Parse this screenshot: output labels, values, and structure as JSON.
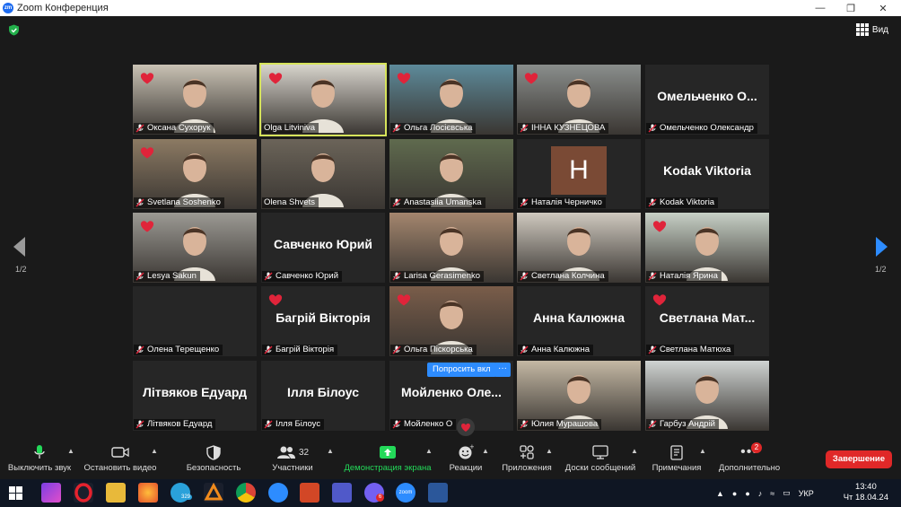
{
  "window": {
    "title": "Zoom Конференция",
    "logo": "zm"
  },
  "view": {
    "label": "Вид"
  },
  "pagination": {
    "left": "1/2",
    "right": "1/2"
  },
  "participants": [
    {
      "name": "Оксана Сухорук",
      "big": "",
      "heart": true,
      "muted": true,
      "bg": "#c9c2b4"
    },
    {
      "name": "Olga Litvinіva",
      "big": "",
      "heart": true,
      "muted": false,
      "bg": "#d7d4cc",
      "active": true
    },
    {
      "name": "Ольга Лосієвська",
      "big": "",
      "heart": true,
      "muted": true,
      "bg": "#5d8a9a"
    },
    {
      "name": "ІННА КУЗНЕЦОВА",
      "big": "",
      "heart": true,
      "muted": true,
      "bg": "#8a8e8c"
    },
    {
      "name": "Омельченко Олександр",
      "big": "Омельченко  О...",
      "heart": false,
      "muted": true,
      "bg": "#262626"
    },
    {
      "name": "Svetlana Soshenko",
      "big": "",
      "heart": true,
      "muted": true,
      "bg": "#8c7a63"
    },
    {
      "name": "Olena Shvets",
      "big": "",
      "heart": false,
      "muted": false,
      "bg": "#6b6459"
    },
    {
      "name": "Anastasiia Umanska",
      "big": "",
      "heart": false,
      "muted": true,
      "bg": "#5f6a4e"
    },
    {
      "name": "Наталія Черничко",
      "big": "",
      "heart": false,
      "muted": true,
      "bg": "#262626",
      "initial": "H"
    },
    {
      "name": "Kodak Viktoria",
      "big": "Kodak Viktoria",
      "heart": false,
      "muted": true,
      "bg": "#262626"
    },
    {
      "name": "Lesya Sakun",
      "big": "",
      "heart": true,
      "muted": true,
      "bg": "#9c9a94"
    },
    {
      "name": "Савченко Юрий",
      "big": "Савченко Юрий",
      "heart": false,
      "muted": true,
      "bg": "#262626"
    },
    {
      "name": "Larisa Gerasimenko",
      "big": "",
      "heart": false,
      "muted": true,
      "bg": "#a4866e"
    },
    {
      "name": "Светлана Колчина",
      "big": "",
      "heart": false,
      "muted": true,
      "bg": "#cfc9bf"
    },
    {
      "name": "Наталія Ярина",
      "big": "",
      "heart": true,
      "muted": true,
      "bg": "#c7d0c6"
    },
    {
      "name": "Олена Терещенко",
      "big": "",
      "heart": false,
      "muted": true,
      "bg": "#262626"
    },
    {
      "name": "Багрій Вікторія",
      "big": "Багрій Вікторія",
      "heart": true,
      "muted": true,
      "bg": "#262626"
    },
    {
      "name": "Ольга Піскорська",
      "big": "",
      "heart": true,
      "muted": true,
      "bg": "#7a5d4a"
    },
    {
      "name": "Анна Калюжна",
      "big": "Анна Калюжна",
      "heart": false,
      "muted": true,
      "bg": "#262626"
    },
    {
      "name": "Светлана Матюха",
      "big": "Светлана  Мат...",
      "heart": true,
      "muted": true,
      "bg": "#262626"
    },
    {
      "name": "Літвяков Едуард",
      "big": "Літвяков Едуард",
      "heart": false,
      "muted": true,
      "bg": "#262626"
    },
    {
      "name": "Ілля Білоус",
      "big": "Ілля Білоус",
      "heart": false,
      "muted": true,
      "bg": "#262626"
    },
    {
      "name": "Мойленко Олена",
      "big": "Мойленко  Оле...",
      "heart": false,
      "muted": true,
      "bg": "#262626"
    },
    {
      "name": "Юлия Мурашова",
      "big": "",
      "heart": false,
      "muted": true,
      "bg": "#c4b8a4"
    },
    {
      "name": "Гарбуз Андрій",
      "big": "",
      "heart": false,
      "muted": true,
      "bg": "#cfd3d2"
    }
  ],
  "namebar_truncated": {
    "22": "Мойленко О"
  },
  "overlay": {
    "ask_button": "Попросить вкл",
    "more_button": "···"
  },
  "toolbar": {
    "mute": "Выключить звук",
    "video": "Остановить видео",
    "security": "Безопасность",
    "participants": "Участники",
    "participants_count": "32",
    "share": "Демонстрация экрана",
    "reactions": "Реакции",
    "apps": "Приложения",
    "whiteboards": "Доски сообщений",
    "notes": "Примечания",
    "more": "Дополнительно",
    "more_badge": "2",
    "end": "Завершение"
  },
  "taskbar": {
    "telegram_badge": "329",
    "viber_badge": "6",
    "zoom_label": "zoom",
    "lang": "УКР",
    "time": "13:40",
    "date": "Чт 18.04.24"
  },
  "colors": {
    "accent": "#2d8cff",
    "share_green": "#23d959",
    "end_red": "#e02828",
    "active_border": "#d6e35b",
    "heart": "#e0243a"
  }
}
